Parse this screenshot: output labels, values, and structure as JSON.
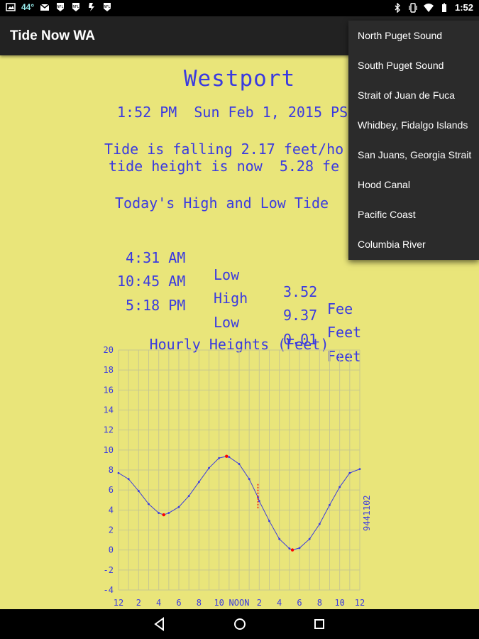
{
  "status_bar": {
    "temperature": "44°",
    "time": "1:52",
    "icons": [
      "image-icon",
      "gmail-icon",
      "nfl-icon",
      "nfl-icon",
      "app-icon",
      "nfl-icon",
      "bluetooth-icon",
      "vibrate-icon",
      "wifi-icon",
      "battery-icon"
    ]
  },
  "app_bar": {
    "title": "Tide Now WA"
  },
  "location": "Westport",
  "datetime": "1:52 PM  Sun Feb 1, 2015 PS",
  "tide_status_line1": "Tide is falling 2.17 feet/ho",
  "tide_status_line2": "tide height is now  5.28 fe",
  "high_low_title": "Today's High and Low Tide",
  "tides": [
    {
      "time": " 4:31 AM",
      "type": "Low",
      "height": "3.52",
      "unit": "Fee"
    },
    {
      "time": "10:45 AM",
      "type": "High",
      "height": "9.37",
      "unit": "Feet"
    },
    {
      "time": " 5:18 PM",
      "type": "Low",
      "height": "0.01",
      "unit": "Feet"
    }
  ],
  "menu": {
    "items": [
      "North Puget Sound",
      "South Puget Sound",
      "Strait of Juan de Fuca",
      "Whidbey, Fidalgo Islands",
      "San Juans, Georgia Strait",
      "Hood Canal",
      "Pacific Coast",
      "Columbia River"
    ]
  },
  "colors": {
    "background": "#e9e57a",
    "text": "#3a3ae0",
    "app_bar": "#222222",
    "menu_bg": "#2b2b2b",
    "highlight_red": "#ff0000"
  },
  "chart_data": {
    "type": "line",
    "title": "Hourly Heights  (Feet)",
    "station_label": "9441102",
    "x_tick_labels": [
      "12",
      "2",
      "4",
      "6",
      "8",
      "10",
      "NOON",
      "2",
      "4",
      "6",
      "8",
      "10",
      "12"
    ],
    "y_tick_labels": [
      "20",
      "18",
      "16",
      "14",
      "12",
      "10",
      "8",
      "6",
      "4",
      "2",
      "0",
      "-2",
      "-4"
    ],
    "xlim": [
      0,
      24
    ],
    "ylim": [
      -4,
      20
    ],
    "grid": true,
    "series": [
      {
        "x": [
          0,
          1,
          2,
          3,
          4,
          4.5,
          5,
          6,
          7,
          8,
          9,
          10,
          10.75,
          11,
          12,
          13,
          13.87,
          14,
          15,
          16,
          17,
          17.3,
          18,
          19,
          20,
          21,
          22,
          23,
          24
        ],
        "values": [
          7.7,
          7.1,
          5.9,
          4.6,
          3.7,
          3.52,
          3.7,
          4.3,
          5.4,
          6.8,
          8.2,
          9.2,
          9.37,
          9.3,
          8.6,
          7.1,
          5.28,
          4.9,
          2.9,
          1.1,
          0.15,
          0.01,
          0.2,
          1.1,
          2.6,
          4.5,
          6.3,
          7.7,
          8.1
        ]
      }
    ],
    "extrema_x": [
      4.5,
      10.75,
      17.3
    ],
    "current_x": 13.87,
    "current_range": [
      4.1,
      6.6
    ]
  }
}
